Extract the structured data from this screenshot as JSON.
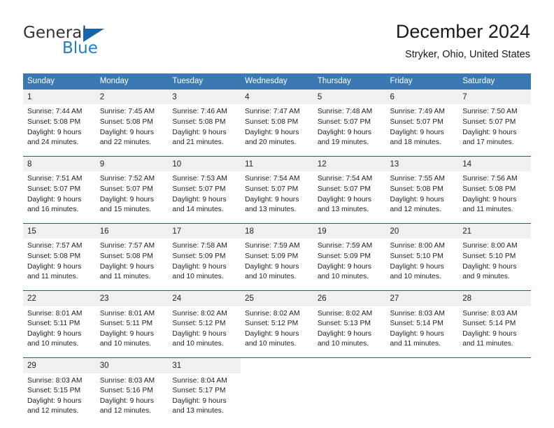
{
  "brand": {
    "name_part1": "General",
    "name_part2": "Blue",
    "logo_icon": "triangle-icon"
  },
  "header": {
    "month_title": "December 2024",
    "location": "Stryker, Ohio, United States"
  },
  "colors": {
    "header_blue": "#3c79b4",
    "separator_blue": "#1f5fa0",
    "daynum_band": "#f0f0f0",
    "brand_blue": "#1f7fc4"
  },
  "weekday_headers": [
    "Sunday",
    "Monday",
    "Tuesday",
    "Wednesday",
    "Thursday",
    "Friday",
    "Saturday"
  ],
  "weeks": [
    {
      "days": [
        {
          "num": "1",
          "sunrise": "Sunrise: 7:44 AM",
          "sunset": "Sunset: 5:08 PM",
          "daylight1": "Daylight: 9 hours",
          "daylight2": "and 24 minutes."
        },
        {
          "num": "2",
          "sunrise": "Sunrise: 7:45 AM",
          "sunset": "Sunset: 5:08 PM",
          "daylight1": "Daylight: 9 hours",
          "daylight2": "and 22 minutes."
        },
        {
          "num": "3",
          "sunrise": "Sunrise: 7:46 AM",
          "sunset": "Sunset: 5:08 PM",
          "daylight1": "Daylight: 9 hours",
          "daylight2": "and 21 minutes."
        },
        {
          "num": "4",
          "sunrise": "Sunrise: 7:47 AM",
          "sunset": "Sunset: 5:08 PM",
          "daylight1": "Daylight: 9 hours",
          "daylight2": "and 20 minutes."
        },
        {
          "num": "5",
          "sunrise": "Sunrise: 7:48 AM",
          "sunset": "Sunset: 5:07 PM",
          "daylight1": "Daylight: 9 hours",
          "daylight2": "and 19 minutes."
        },
        {
          "num": "6",
          "sunrise": "Sunrise: 7:49 AM",
          "sunset": "Sunset: 5:07 PM",
          "daylight1": "Daylight: 9 hours",
          "daylight2": "and 18 minutes."
        },
        {
          "num": "7",
          "sunrise": "Sunrise: 7:50 AM",
          "sunset": "Sunset: 5:07 PM",
          "daylight1": "Daylight: 9 hours",
          "daylight2": "and 17 minutes."
        }
      ]
    },
    {
      "days": [
        {
          "num": "8",
          "sunrise": "Sunrise: 7:51 AM",
          "sunset": "Sunset: 5:07 PM",
          "daylight1": "Daylight: 9 hours",
          "daylight2": "and 16 minutes."
        },
        {
          "num": "9",
          "sunrise": "Sunrise: 7:52 AM",
          "sunset": "Sunset: 5:07 PM",
          "daylight1": "Daylight: 9 hours",
          "daylight2": "and 15 minutes."
        },
        {
          "num": "10",
          "sunrise": "Sunrise: 7:53 AM",
          "sunset": "Sunset: 5:07 PM",
          "daylight1": "Daylight: 9 hours",
          "daylight2": "and 14 minutes."
        },
        {
          "num": "11",
          "sunrise": "Sunrise: 7:54 AM",
          "sunset": "Sunset: 5:07 PM",
          "daylight1": "Daylight: 9 hours",
          "daylight2": "and 13 minutes."
        },
        {
          "num": "12",
          "sunrise": "Sunrise: 7:54 AM",
          "sunset": "Sunset: 5:07 PM",
          "daylight1": "Daylight: 9 hours",
          "daylight2": "and 13 minutes."
        },
        {
          "num": "13",
          "sunrise": "Sunrise: 7:55 AM",
          "sunset": "Sunset: 5:08 PM",
          "daylight1": "Daylight: 9 hours",
          "daylight2": "and 12 minutes."
        },
        {
          "num": "14",
          "sunrise": "Sunrise: 7:56 AM",
          "sunset": "Sunset: 5:08 PM",
          "daylight1": "Daylight: 9 hours",
          "daylight2": "and 11 minutes."
        }
      ]
    },
    {
      "days": [
        {
          "num": "15",
          "sunrise": "Sunrise: 7:57 AM",
          "sunset": "Sunset: 5:08 PM",
          "daylight1": "Daylight: 9 hours",
          "daylight2": "and 11 minutes."
        },
        {
          "num": "16",
          "sunrise": "Sunrise: 7:57 AM",
          "sunset": "Sunset: 5:08 PM",
          "daylight1": "Daylight: 9 hours",
          "daylight2": "and 11 minutes."
        },
        {
          "num": "17",
          "sunrise": "Sunrise: 7:58 AM",
          "sunset": "Sunset: 5:09 PM",
          "daylight1": "Daylight: 9 hours",
          "daylight2": "and 10 minutes."
        },
        {
          "num": "18",
          "sunrise": "Sunrise: 7:59 AM",
          "sunset": "Sunset: 5:09 PM",
          "daylight1": "Daylight: 9 hours",
          "daylight2": "and 10 minutes."
        },
        {
          "num": "19",
          "sunrise": "Sunrise: 7:59 AM",
          "sunset": "Sunset: 5:09 PM",
          "daylight1": "Daylight: 9 hours",
          "daylight2": "and 10 minutes."
        },
        {
          "num": "20",
          "sunrise": "Sunrise: 8:00 AM",
          "sunset": "Sunset: 5:10 PM",
          "daylight1": "Daylight: 9 hours",
          "daylight2": "and 10 minutes."
        },
        {
          "num": "21",
          "sunrise": "Sunrise: 8:00 AM",
          "sunset": "Sunset: 5:10 PM",
          "daylight1": "Daylight: 9 hours",
          "daylight2": "and 9 minutes."
        }
      ]
    },
    {
      "days": [
        {
          "num": "22",
          "sunrise": "Sunrise: 8:01 AM",
          "sunset": "Sunset: 5:11 PM",
          "daylight1": "Daylight: 9 hours",
          "daylight2": "and 10 minutes."
        },
        {
          "num": "23",
          "sunrise": "Sunrise: 8:01 AM",
          "sunset": "Sunset: 5:11 PM",
          "daylight1": "Daylight: 9 hours",
          "daylight2": "and 10 minutes."
        },
        {
          "num": "24",
          "sunrise": "Sunrise: 8:02 AM",
          "sunset": "Sunset: 5:12 PM",
          "daylight1": "Daylight: 9 hours",
          "daylight2": "and 10 minutes."
        },
        {
          "num": "25",
          "sunrise": "Sunrise: 8:02 AM",
          "sunset": "Sunset: 5:12 PM",
          "daylight1": "Daylight: 9 hours",
          "daylight2": "and 10 minutes."
        },
        {
          "num": "26",
          "sunrise": "Sunrise: 8:02 AM",
          "sunset": "Sunset: 5:13 PM",
          "daylight1": "Daylight: 9 hours",
          "daylight2": "and 10 minutes."
        },
        {
          "num": "27",
          "sunrise": "Sunrise: 8:03 AM",
          "sunset": "Sunset: 5:14 PM",
          "daylight1": "Daylight: 9 hours",
          "daylight2": "and 11 minutes."
        },
        {
          "num": "28",
          "sunrise": "Sunrise: 8:03 AM",
          "sunset": "Sunset: 5:14 PM",
          "daylight1": "Daylight: 9 hours",
          "daylight2": "and 11 minutes."
        }
      ]
    },
    {
      "days": [
        {
          "num": "29",
          "sunrise": "Sunrise: 8:03 AM",
          "sunset": "Sunset: 5:15 PM",
          "daylight1": "Daylight: 9 hours",
          "daylight2": "and 12 minutes."
        },
        {
          "num": "30",
          "sunrise": "Sunrise: 8:03 AM",
          "sunset": "Sunset: 5:16 PM",
          "daylight1": "Daylight: 9 hours",
          "daylight2": "and 12 minutes."
        },
        {
          "num": "31",
          "sunrise": "Sunrise: 8:04 AM",
          "sunset": "Sunset: 5:17 PM",
          "daylight1": "Daylight: 9 hours",
          "daylight2": "and 13 minutes."
        },
        {
          "num": "",
          "sunrise": "",
          "sunset": "",
          "daylight1": "",
          "daylight2": ""
        },
        {
          "num": "",
          "sunrise": "",
          "sunset": "",
          "daylight1": "",
          "daylight2": ""
        },
        {
          "num": "",
          "sunrise": "",
          "sunset": "",
          "daylight1": "",
          "daylight2": ""
        },
        {
          "num": "",
          "sunrise": "",
          "sunset": "",
          "daylight1": "",
          "daylight2": ""
        }
      ]
    }
  ]
}
